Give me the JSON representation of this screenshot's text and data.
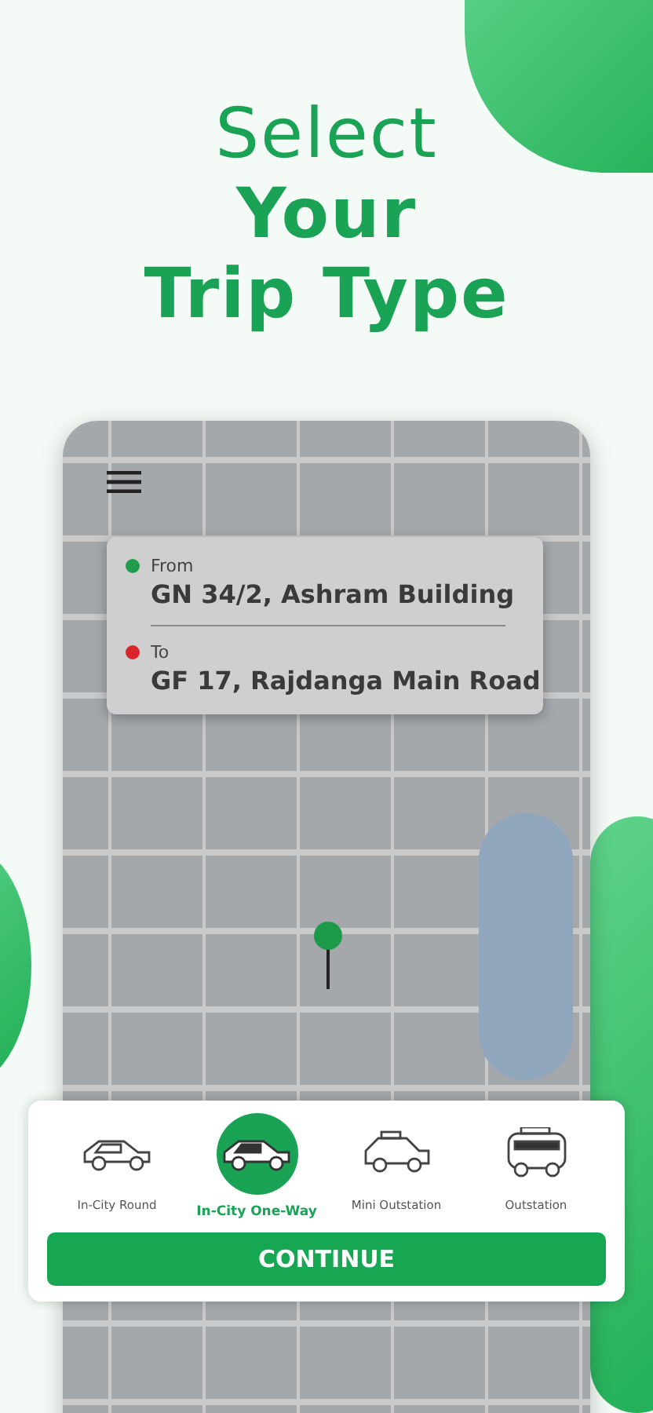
{
  "headline": {
    "lines": [
      {
        "text": "Select",
        "bold": false
      },
      {
        "text": "Your",
        "bold": true
      },
      {
        "text": "Trip Type",
        "bold": true
      }
    ]
  },
  "route": [
    {
      "label": "From",
      "value": "GN 34/2, Ashram Building",
      "color": "#1f9d4c"
    },
    {
      "label": "To",
      "value": "GF 17, Rajdanga Main Road",
      "color": "#d8262c"
    }
  ],
  "trip_types": [
    {
      "label": "In-City Round",
      "selected": false,
      "kind": "hatchback"
    },
    {
      "label": "In-City One-Way",
      "selected": true,
      "kind": "hatchback"
    },
    {
      "label": "Mini Outstation",
      "selected": false,
      "kind": "suv"
    },
    {
      "label": "Outstation",
      "selected": false,
      "kind": "van"
    }
  ],
  "continue_button": "CONTINUE"
}
